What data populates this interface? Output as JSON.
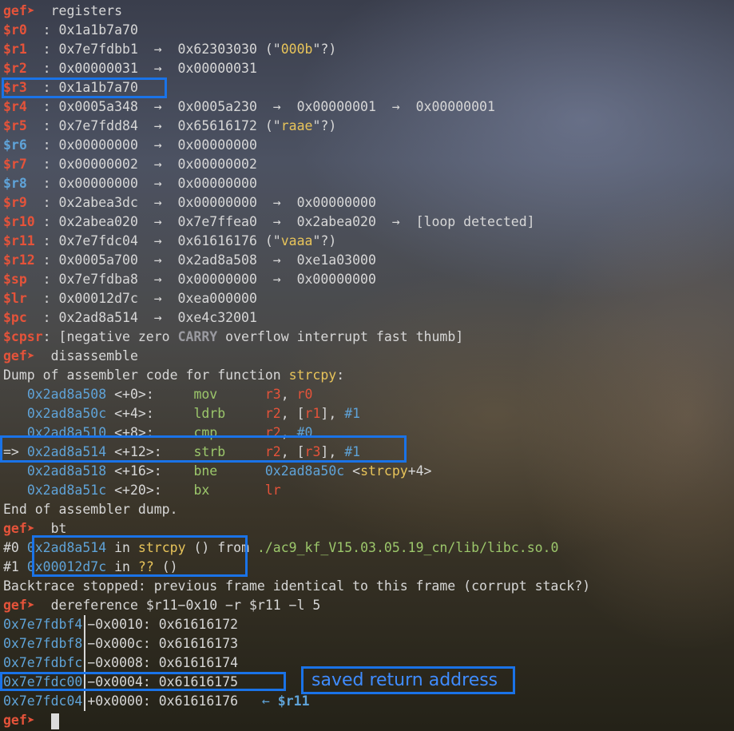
{
  "cmd1": {
    "prompt": "gef➤",
    "command": "registers"
  },
  "registers": [
    {
      "name": "$r0 ",
      "value": "0x1a1b7a70",
      "chain": ""
    },
    {
      "name": "$r1 ",
      "value": "0x7e7fdbb1",
      "chain": "  →  0x62303030 (\"",
      "str": "000b",
      "tail": "\"?)"
    },
    {
      "name": "$r2 ",
      "value": "0x00000031",
      "chain": "  →  0x00000031"
    },
    {
      "name": "$r3 ",
      "value": "0x1a1b7a70",
      "chain": ""
    },
    {
      "name": "$r4 ",
      "value": "0x0005a348",
      "chain": "  →  0x0005a230  →  0x00000001  →  0x00000001"
    },
    {
      "name": "$r5 ",
      "value": "0x7e7fdd84",
      "chain": "  →  0x65616172 (\"",
      "str": "raae",
      "tail": "\"?)"
    },
    {
      "name": "$r6 ",
      "value": "0x00000000",
      "chain": "  →  0x00000000"
    },
    {
      "name": "$r7 ",
      "value": "0x00000002",
      "chain": "  →  0x00000002"
    },
    {
      "name": "$r8 ",
      "value": "0x00000000",
      "chain": "  →  0x00000000"
    },
    {
      "name": "$r9 ",
      "value": "0x2abea3dc",
      "chain": "  →  0x00000000  →  0x00000000"
    },
    {
      "name": "$r10",
      "value": "0x2abea020",
      "chain": "  →  0x7e7ffea0  →  0x2abea020  →  [loop detected]"
    },
    {
      "name": "$r11",
      "value": "0x7e7fdc04",
      "chain": "  →  0x61616176 (\"",
      "str": "vaaa",
      "tail": "\"?)"
    },
    {
      "name": "$r12",
      "value": "0x0005a700",
      "chain": "  →  0x2ad8a508  →  0xe1a03000"
    },
    {
      "name": "$sp ",
      "value": "0x7e7fdba8",
      "chain": "  →  0x00000000  →  0x00000000"
    },
    {
      "name": "$lr ",
      "value": "0x00012d7c",
      "chain": "  →  0xea000000"
    },
    {
      "name": "$pc ",
      "value": "0x2ad8a514",
      "chain": "  →  0xe4c32001"
    }
  ],
  "cpsr": {
    "name": "$cpsr",
    "pre": ": [negative zero ",
    "carry": "CARRY",
    "post": " overflow interrupt fast thumb]"
  },
  "cmd2": {
    "prompt": "gef➤",
    "command": "disassemble"
  },
  "dump_header": {
    "text": "Dump of assembler code for function ",
    "fn": "strcpy",
    "colon": ":"
  },
  "asm": [
    {
      "marker": "   ",
      "addr": "0x2ad8a508",
      "off": "<+0>:     ",
      "mn": "mov ",
      "ops": [
        [
          "r3",
          "reg"
        ],
        [
          ", ",
          ""
        ],
        [
          "r0",
          "reg"
        ]
      ]
    },
    {
      "marker": "   ",
      "addr": "0x2ad8a50c",
      "off": "<+4>:     ",
      "mn": "ldrb",
      "ops": [
        [
          "r2",
          "reg"
        ],
        [
          ", [",
          ""
        ],
        [
          "r1",
          "reg"
        ],
        [
          "], ",
          ""
        ],
        [
          "#1",
          "imm"
        ]
      ]
    },
    {
      "marker": "   ",
      "addr": "0x2ad8a510",
      "off": "<+8>:     ",
      "mn": "cmp ",
      "ops": [
        [
          "r2",
          "reg"
        ],
        [
          ", ",
          ""
        ],
        [
          "#0",
          "imm"
        ]
      ]
    },
    {
      "marker": "=> ",
      "addr": "0x2ad8a514",
      "off": "<+12>:    ",
      "mn": "strb",
      "ops": [
        [
          "r2",
          "reg"
        ],
        [
          ", [",
          ""
        ],
        [
          "r3",
          "reg"
        ],
        [
          "], ",
          ""
        ],
        [
          "#1",
          "imm"
        ]
      ]
    },
    {
      "marker": "   ",
      "addr": "0x2ad8a518",
      "off": "<+16>:    ",
      "mn": "bne ",
      "ops": [
        [
          "0x2ad8a50c",
          "addr"
        ],
        [
          " <",
          ""
        ],
        [
          "strcpy",
          "fn"
        ],
        [
          "+4>",
          ""
        ]
      ]
    },
    {
      "marker": "   ",
      "addr": "0x2ad8a51c",
      "off": "<+20>:    ",
      "mn": "bx  ",
      "ops": [
        [
          "lr",
          "reg"
        ]
      ]
    }
  ],
  "dump_footer": "End of assembler dump.",
  "cmd3": {
    "prompt": "gef➤",
    "command": "bt"
  },
  "bt": [
    {
      "num": "#0 ",
      "addr": "0x2ad8a514",
      "in": " in ",
      "fn": "strcpy",
      "args": " () ",
      "from": "from ",
      "path": "./ac9_kf_V15.03.05.19_cn/lib/libc.so.0"
    },
    {
      "num": "#1 ",
      "addr": "0x00012d7c",
      "in": " in ",
      "fn": "??",
      "args": " ()",
      "from": "",
      "path": ""
    }
  ],
  "bt_footer": "Backtrace stopped: previous frame identical to this frame (corrupt stack?)",
  "cmd4": {
    "prompt": "gef➤",
    "command": "dereference $r11−0x10 −r $r11 −l 5"
  },
  "deref": [
    {
      "addr": "0x7e7fdbf4",
      "off": "−0x0010: 0x61616172",
      "note": ""
    },
    {
      "addr": "0x7e7fdbf8",
      "off": "−0x000c: 0x61616173",
      "note": ""
    },
    {
      "addr": "0x7e7fdbfc",
      "off": "−0x0008: 0x61616174",
      "note": ""
    },
    {
      "addr": "0x7e7fdc00",
      "off": "−0x0004: 0x61616175",
      "note": ""
    },
    {
      "addr": "0x7e7fdc04",
      "off": "+0x0000: 0x61616176",
      "note": "   ← ",
      "reg": "$r11"
    }
  ],
  "annotation": "saved return address",
  "final_prompt": "gef➤"
}
